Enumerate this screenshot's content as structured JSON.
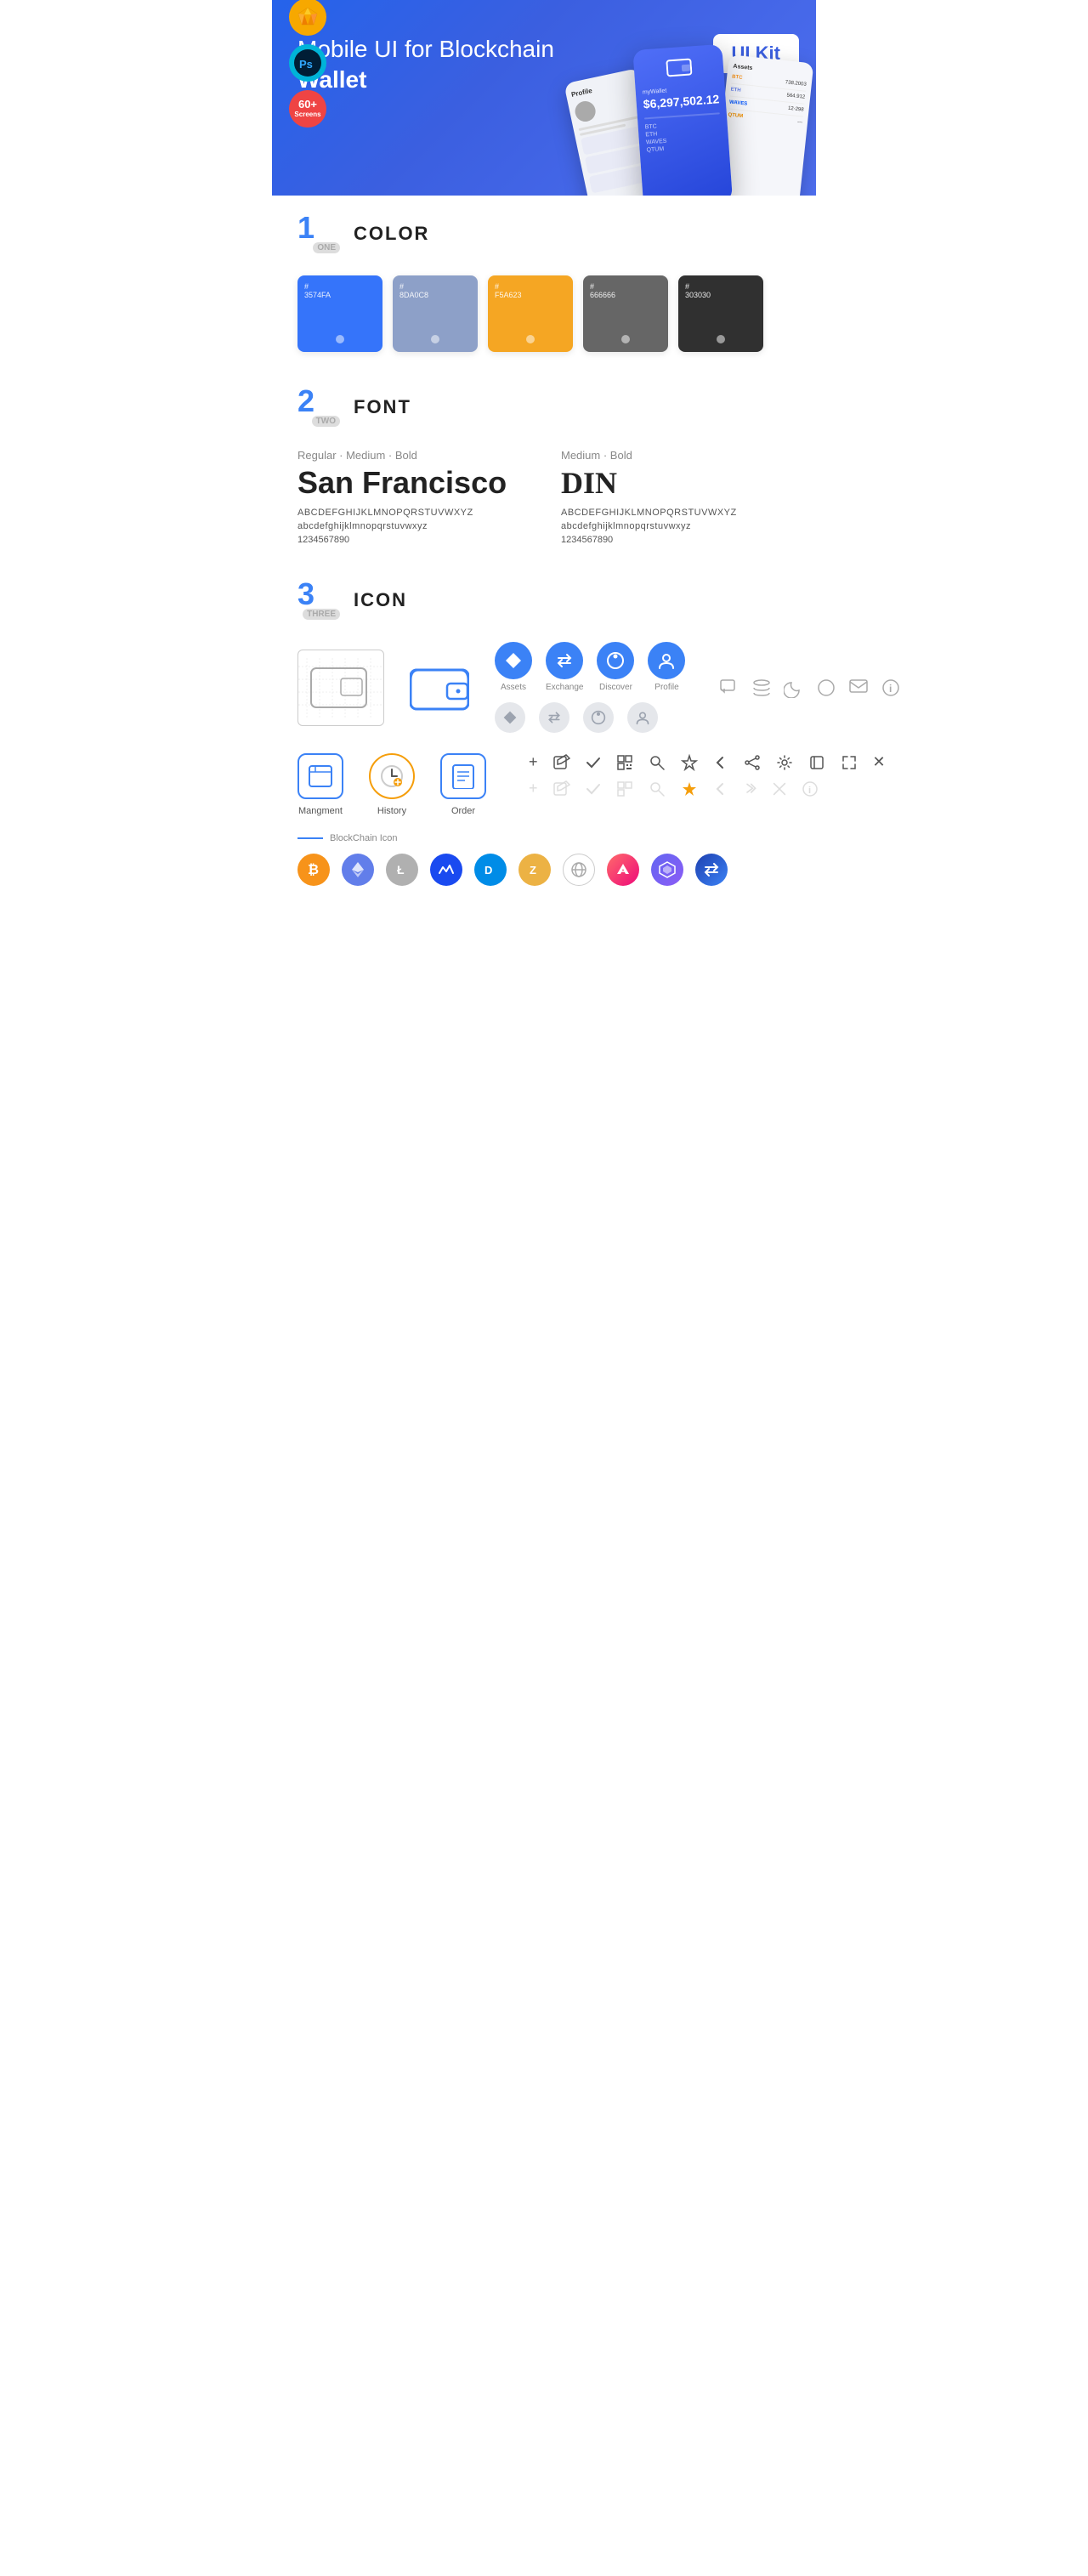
{
  "hero": {
    "title_part1": "Mobile UI for Blockchain ",
    "title_bold": "Wallet",
    "badge": "UI Kit",
    "badge_sketch": "S",
    "badge_ps": "Ps",
    "badge_screens_num": "60+",
    "badge_screens_label": "Screens"
  },
  "sections": {
    "color": {
      "number": "1",
      "number_word": "ONE",
      "title": "COLOR",
      "swatches": [
        {
          "hex": "#3574FA",
          "label": "3574FA",
          "bg": "#3574FA"
        },
        {
          "hex": "#8DA0C8",
          "label": "8DA0C8",
          "bg": "#8DA0C8"
        },
        {
          "hex": "#F5A623",
          "label": "F5A623",
          "bg": "#F5A623"
        },
        {
          "hex": "#666666",
          "label": "666666",
          "bg": "#666666"
        },
        {
          "hex": "#303030",
          "label": "303030",
          "bg": "#303030"
        }
      ]
    },
    "font": {
      "number": "2",
      "number_word": "TWO",
      "title": "FONT",
      "font1": {
        "weights": "Regular · Medium · Bold",
        "name": "San Francisco",
        "uppercase": "ABCDEFGHIJKLMNOPQRSTUVWXYZ",
        "lowercase": "abcdefghijklmnopqrstuvwxyz",
        "numbers": "1234567890"
      },
      "font2": {
        "weights": "Medium · Bold",
        "name": "DIN",
        "uppercase": "ABCDEFGHIJKLMNOPQRSTUVWXYZ",
        "lowercase": "abcdefghijklmnopqrstuvwxyz",
        "numbers": "1234567890"
      }
    },
    "icon": {
      "number": "3",
      "number_word": "THREE",
      "title": "ICON",
      "nav_icons": [
        {
          "label": "Assets",
          "color": "#3b82f6"
        },
        {
          "label": "Exchange",
          "color": "#3b82f6"
        },
        {
          "label": "Discover",
          "color": "#3b82f6"
        },
        {
          "label": "Profile",
          "color": "#3b82f6"
        }
      ],
      "action_icons": [
        {
          "label": "Mangment"
        },
        {
          "label": "History"
        },
        {
          "label": "Order"
        }
      ],
      "blockchain_label": "BlockChain Icon",
      "crypto": [
        {
          "label": "BTC",
          "color": "#f7931a"
        },
        {
          "label": "ETH",
          "color": "#627eea"
        },
        {
          "label": "LTC",
          "color": "#a0a0a0"
        },
        {
          "label": "WAVES",
          "color": "#0055ff"
        },
        {
          "label": "DASH",
          "color": "#008ce7"
        },
        {
          "label": "ZEC",
          "color": "#ecb244"
        },
        {
          "label": "NET",
          "color": "#e8e8e8"
        },
        {
          "label": "AE",
          "color": "#ff0a0a"
        },
        {
          "label": "POLY",
          "color": "#5246d5"
        },
        {
          "label": "SWAP",
          "color": "#2b2b8a"
        }
      ]
    }
  }
}
